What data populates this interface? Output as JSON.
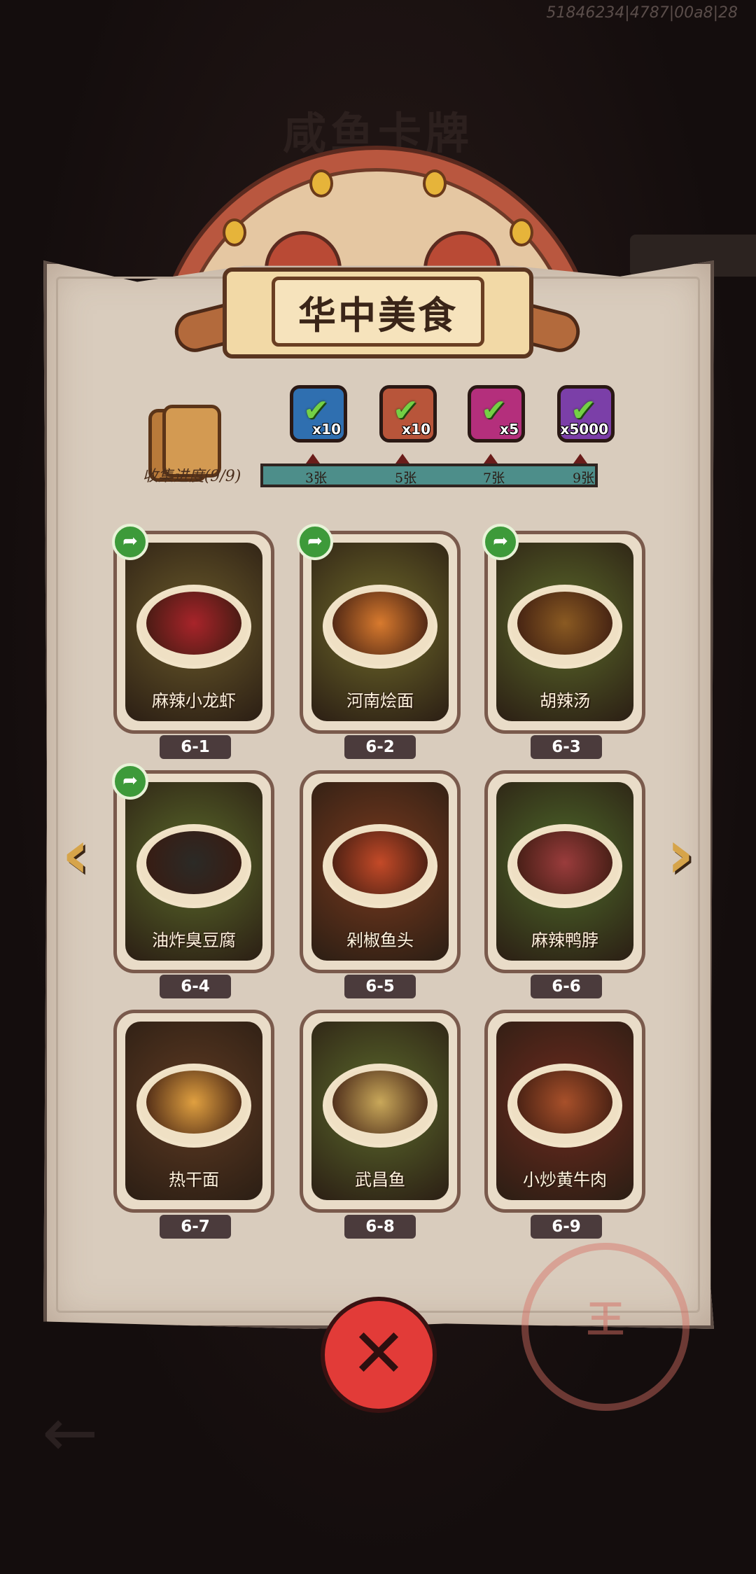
{
  "debug_id": "51846234|4787|00a8|28",
  "background": {
    "title": "咸鱼卡牌"
  },
  "banner": {
    "title": "华中美食"
  },
  "collection": {
    "label": "收集进度(9/9)",
    "rewards": [
      {
        "icon": "chest-icon",
        "qty": "x10",
        "color": "#2f6fb0"
      },
      {
        "icon": "scroll-icon",
        "qty": "x10",
        "color": "#b8553a"
      },
      {
        "icon": "gem-icon",
        "qty": "x5",
        "color": "#b42f7c"
      },
      {
        "icon": "crystal-icon",
        "qty": "x5000",
        "color": "#7b3fa8"
      }
    ],
    "ticks": [
      "3张",
      "5张",
      "7张",
      "9张"
    ],
    "progress": 1.0
  },
  "cards": [
    {
      "id": "6-1",
      "name": "麻辣小龙虾",
      "shared": true,
      "bg": "#6a5a2a",
      "food": "#a8242a"
    },
    {
      "id": "6-2",
      "name": "河南烩面",
      "shared": true,
      "bg": "#6f6a2a",
      "food": "#d87a2e"
    },
    {
      "id": "6-3",
      "name": "胡辣汤",
      "shared": true,
      "bg": "#5b6a2a",
      "food": "#8a5a22"
    },
    {
      "id": "6-4",
      "name": "油炸臭豆腐",
      "shared": true,
      "bg": "#5a6a2a",
      "food": "#2b2a26"
    },
    {
      "id": "6-5",
      "name": "剁椒鱼头",
      "shared": false,
      "bg": "#7a3a1e",
      "food": "#c44a28"
    },
    {
      "id": "6-6",
      "name": "麻辣鸭脖",
      "shared": false,
      "bg": "#4e6a2a",
      "food": "#9a3c3c"
    },
    {
      "id": "6-7",
      "name": "热干面",
      "shared": false,
      "bg": "#5e3a22",
      "food": "#e0a040"
    },
    {
      "id": "6-8",
      "name": "武昌鱼",
      "shared": false,
      "bg": "#5c6b2c",
      "food": "#c9a85a"
    },
    {
      "id": "6-9",
      "name": "小炒黄牛肉",
      "shared": false,
      "bg": "#6e2a1e",
      "food": "#a8502a"
    }
  ],
  "nav": {
    "prev_glyph": "‹",
    "next_glyph": "›"
  },
  "close": {
    "glyph": "✕"
  },
  "stamp": {
    "text": "王"
  }
}
